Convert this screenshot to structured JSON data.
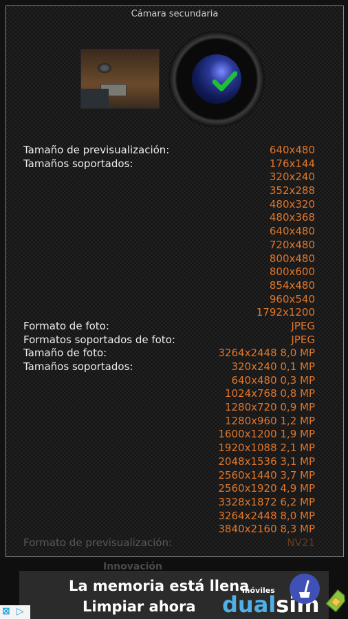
{
  "title": "Cámara secundaria",
  "rows": [
    {
      "label": "Tamaño de previsualización:",
      "value": "640x480"
    },
    {
      "label": "Tamaños soportados:",
      "value": "176x144"
    },
    {
      "label": "",
      "value": "320x240"
    },
    {
      "label": "",
      "value": "352x288"
    },
    {
      "label": "",
      "value": "480x320"
    },
    {
      "label": "",
      "value": "480x368"
    },
    {
      "label": "",
      "value": "640x480"
    },
    {
      "label": "",
      "value": "720x480"
    },
    {
      "label": "",
      "value": "800x480"
    },
    {
      "label": "",
      "value": "800x600"
    },
    {
      "label": "",
      "value": "854x480"
    },
    {
      "label": "",
      "value": "960x540"
    },
    {
      "label": "",
      "value": "1792x1200"
    },
    {
      "label": "Formato de foto:",
      "value": "JPEG"
    },
    {
      "label": "Formatos soportados de foto:",
      "value": "JPEG"
    },
    {
      "label": "Tamaño de foto:",
      "value": "3264x2448 8,0 MP"
    },
    {
      "label": "Tamaños soportados:",
      "value": "320x240 0,1 MP"
    },
    {
      "label": "",
      "value": "640x480 0,3 MP"
    },
    {
      "label": "",
      "value": "1024x768 0,8 MP"
    },
    {
      "label": "",
      "value": "1280x720 0,9 MP"
    },
    {
      "label": "",
      "value": "1280x960 1,2 MP"
    },
    {
      "label": "",
      "value": "1600x1200 1,9 MP"
    },
    {
      "label": "",
      "value": "1920x1088 2,1 MP"
    },
    {
      "label": "",
      "value": "2048x1536 3,1 MP"
    },
    {
      "label": "",
      "value": "2560x1440 3,7 MP"
    },
    {
      "label": "",
      "value": "2560x1920 4,9 MP"
    },
    {
      "label": "",
      "value": "3328x1872 6,2 MP"
    },
    {
      "label": "",
      "value": "3264x2448 8,0 MP"
    },
    {
      "label": "",
      "value": "3840x2160 8,3 MP"
    }
  ],
  "partial_row": {
    "label": "Formato de previsualización:",
    "value": "NV21"
  },
  "ad": {
    "ghost_text": "Innovación",
    "line1": "La memoria está llena",
    "line2": "Limpiar ahora",
    "brand_small": "móviles",
    "brand_dual": "dual",
    "brand_sim": "sim",
    "icons": [
      "broom-icon",
      "sim-card-icon",
      "adchoices-icon"
    ]
  },
  "colors": {
    "value": "#e0762a",
    "label": "#ededed",
    "brand_blue": "#4fb0e8",
    "button_blue": "#3f51b5"
  }
}
